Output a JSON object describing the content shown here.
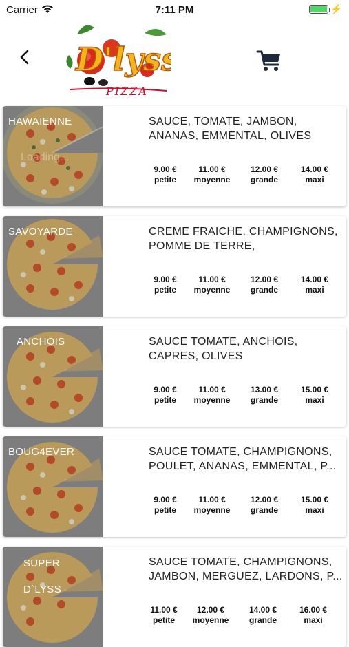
{
  "status_bar": {
    "carrier": "Carrier",
    "time": "7:11 PM",
    "battery_level": 1.0
  },
  "header": {
    "logo_text": "D'lyss",
    "logo_subtext": "PIZZA"
  },
  "pizzas": [
    {
      "name": "HAWAIENNE",
      "loading": "Loading...",
      "ingredients": "SAUCE, TOMATE, JAMBON, ANANAS, EMMENTAL, OLIVES",
      "prices": [
        {
          "price": "9.00 €",
          "size": "petite"
        },
        {
          "price": "11.00 €",
          "size": "moyenne"
        },
        {
          "price": "12.00 €",
          "size": "grande"
        },
        {
          "price": "14.00 €",
          "size": "maxi"
        }
      ]
    },
    {
      "name": "SAVOYARDE",
      "ingredients": "CREME FRAICHE, CHAMPIGNONS, POMME DE TERRE, REBLOCHON,...",
      "prices": [
        {
          "price": "9.00 €",
          "size": "petite"
        },
        {
          "price": "11.00 €",
          "size": "moyenne"
        },
        {
          "price": "12.00 €",
          "size": "grande"
        },
        {
          "price": "14.00 €",
          "size": "maxi"
        }
      ]
    },
    {
      "name": "ANCHOIS",
      "ingredients": "SAUCE TOMATE, ANCHOIS, CAPRES, OLIVES",
      "prices": [
        {
          "price": "9.00 €",
          "size": "petite"
        },
        {
          "price": "11.00 €",
          "size": "moyenne"
        },
        {
          "price": "13.00 €",
          "size": "grande"
        },
        {
          "price": "15.00 €",
          "size": "maxi"
        }
      ]
    },
    {
      "name": "BOUG4EVER",
      "ingredients": "SAUCE TOMATE, CHAMPIGNONS, POULET, ANANAS, EMMENTAL, P...",
      "prices": [
        {
          "price": "9.00 €",
          "size": "petite"
        },
        {
          "price": "11.00 €",
          "size": "moyenne"
        },
        {
          "price": "12.00 €",
          "size": "grande"
        },
        {
          "price": "15.00 €",
          "size": "maxi"
        }
      ]
    },
    {
      "name": "SUPER\nD`LYSS",
      "ingredients": "SAUCE TOMATE, CHAMPIGNONS, JAMBON, MERGUEZ, LARDONS, P...",
      "prices": [
        {
          "price": "11.00 €",
          "size": "petite"
        },
        {
          "price": "12.00 €",
          "size": "moyenne"
        },
        {
          "price": "14.00 €",
          "size": "grande"
        },
        {
          "price": "16.00 €",
          "size": "maxi"
        }
      ]
    }
  ]
}
